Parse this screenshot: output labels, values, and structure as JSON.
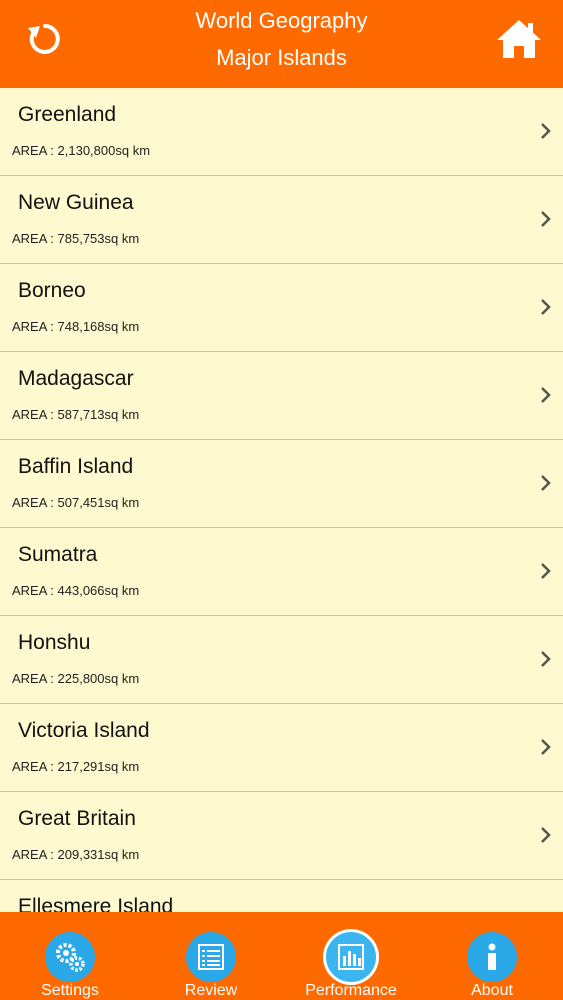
{
  "header": {
    "title": "World Geography",
    "subtitle": "Major Islands",
    "back_icon": "refresh-icon",
    "home_icon": "home-icon"
  },
  "islands": [
    {
      "name": "Greenland",
      "area": "AREA : 2,130,800sq km"
    },
    {
      "name": "New Guinea",
      "area": "AREA : 785,753sq km"
    },
    {
      "name": "Borneo",
      "area": "AREA : 748,168sq km"
    },
    {
      "name": "Madagascar",
      "area": "AREA : 587,713sq km"
    },
    {
      "name": "Baffin Island",
      "area": "AREA : 507,451sq km"
    },
    {
      "name": "Sumatra",
      "area": "AREA : 443,066sq km"
    },
    {
      "name": "Honshu",
      "area": "AREA : 225,800sq km"
    },
    {
      "name": "Victoria Island",
      "area": "AREA : 217,291sq km"
    },
    {
      "name": "Great Britain",
      "area": "AREA : 209,331sq km"
    },
    {
      "name": "Ellesmere Island",
      "area": ""
    }
  ],
  "tabs": [
    {
      "label": "Settings",
      "icon": "gears-icon"
    },
    {
      "label": "Review",
      "icon": "list-icon"
    },
    {
      "label": "Performance",
      "icon": "bar-chart-icon"
    },
    {
      "label": "About",
      "icon": "info-icon"
    }
  ],
  "colors": {
    "header_bg": "#ff6a00",
    "list_bg": "#fff9cf",
    "tab_icon_bg": "#2aa8e8"
  }
}
